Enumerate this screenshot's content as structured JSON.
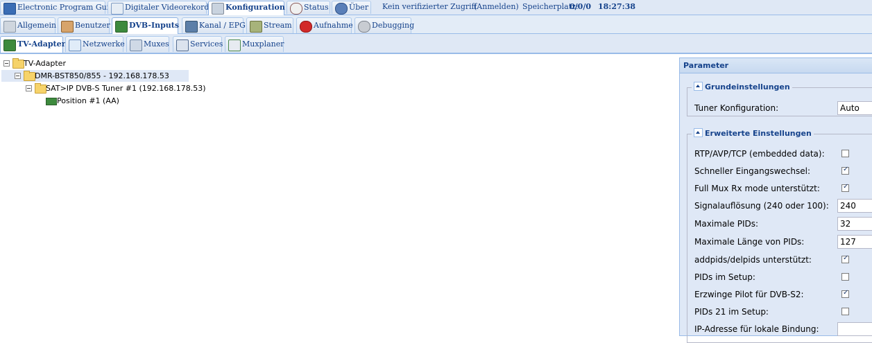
{
  "top_nav": {
    "tabs": [
      {
        "label": "Electronic Program Guide",
        "icon": "epg-icon"
      },
      {
        "label": "Digitaler Videorekorder",
        "icon": "download-icon"
      },
      {
        "label": "Konfiguration",
        "icon": "wrench-icon",
        "active": true
      },
      {
        "label": "Status",
        "icon": "eye-icon"
      },
      {
        "label": "Über",
        "icon": "info-icon"
      }
    ],
    "access_text": "Kein verifizierter Zugriff",
    "login_link": "(Anmelden)",
    "storage_label": "Speicherplatz:",
    "storage_value": "0/0/0",
    "time": "18:27:38"
  },
  "config_tabs": [
    {
      "label": "Allgemein",
      "icon": "tools-icon"
    },
    {
      "label": "Benutzer",
      "icon": "users-icon"
    },
    {
      "label": "DVB-Inputs",
      "icon": "tuner-card-icon",
      "active": true
    },
    {
      "label": "Kanal / EPG",
      "icon": "tv-icon"
    },
    {
      "label": "Stream",
      "icon": "stream-icon"
    },
    {
      "label": "Aufnahme",
      "icon": "rec-icon"
    },
    {
      "label": "Debugging",
      "icon": "debug-icon"
    }
  ],
  "dvb_tabs": [
    {
      "label": "TV-Adapter",
      "icon": "tuner-card-icon",
      "active": true
    },
    {
      "label": "Netzwerke",
      "icon": "network-icon"
    },
    {
      "label": "Muxes",
      "icon": "satellite-icon"
    },
    {
      "label": "Services",
      "icon": "services-icon"
    },
    {
      "label": "Muxplaner",
      "icon": "planner-icon"
    }
  ],
  "tree": {
    "root": "TV-Adapter",
    "device": "DMR-BST850/855 - 192.168.178.53",
    "tuner": "SAT>IP DVB-S Tuner #1 (192.168.178.53)",
    "position": "Position #1 (AA)"
  },
  "parameter_panel": {
    "title": "Parameter",
    "basic": {
      "legend": "Grundeinstellungen",
      "tuner_config_label": "Tuner Konfiguration:",
      "tuner_config_value": "Auto"
    },
    "advanced": {
      "legend": "Erweiterte Einstellungen",
      "rows": [
        {
          "label": "RTP/AVP/TCP (embedded data):",
          "type": "checkbox",
          "checked": false
        },
        {
          "label": "Schneller Eingangswechsel:",
          "type": "checkbox",
          "checked": true
        },
        {
          "label": "Full Mux Rx mode unterstützt:",
          "type": "checkbox",
          "checked": true
        },
        {
          "label": "Signalauflösung (240 oder 100):",
          "type": "text",
          "value": "240"
        },
        {
          "label": "Maximale PIDs:",
          "type": "text",
          "value": "32"
        },
        {
          "label": "Maximale Länge von PIDs:",
          "type": "text",
          "value": "127"
        },
        {
          "label": "addpids/delpids unterstützt:",
          "type": "checkbox",
          "checked": true
        },
        {
          "label": "PIDs im Setup:",
          "type": "checkbox",
          "checked": false
        },
        {
          "label": "Erzwinge Pilot für DVB-S2:",
          "type": "checkbox",
          "checked": true,
          "highlighted": true
        },
        {
          "label": "PIDs 21 im Setup:",
          "type": "checkbox",
          "checked": false
        },
        {
          "label": "IP-Adresse für lokale Bindung:",
          "type": "text",
          "value": ""
        }
      ]
    }
  },
  "colors": {
    "highlight": "#f4f13c",
    "nav_text": "#15428b",
    "panel_bg": "#dfe8f6",
    "border": "#99bbe8"
  }
}
